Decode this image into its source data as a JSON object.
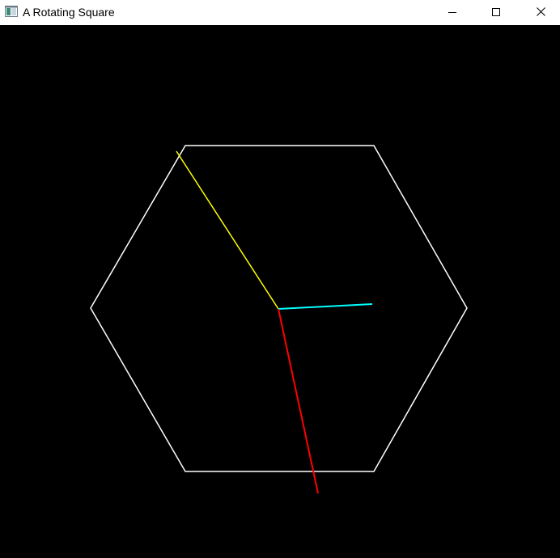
{
  "window": {
    "title": "A Rotating Square"
  },
  "icons": {
    "app": "app-window-icon",
    "minimize": "minimize-icon",
    "maximize": "maximize-icon",
    "close": "close-icon"
  },
  "colors": {
    "canvas_background": "#000000",
    "hexagon_outline": "#ffffff",
    "line_yellow": "#ffff00",
    "line_cyan": "#00ffff",
    "line_red": "#ff0000"
  }
}
